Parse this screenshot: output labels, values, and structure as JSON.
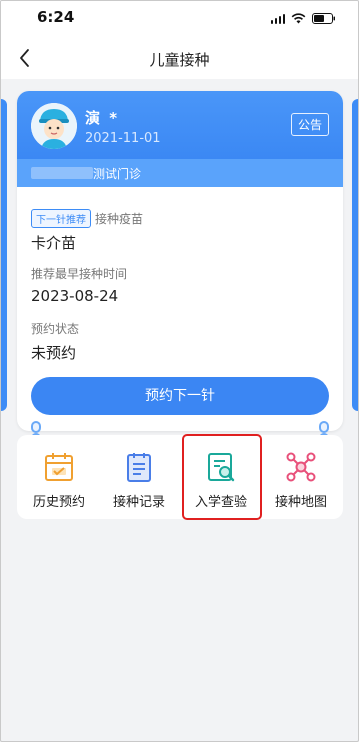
{
  "status_bar": {
    "time": "6:24"
  },
  "nav": {
    "title": "儿童接种"
  },
  "child": {
    "name": "演 *",
    "dob": "2021-11-01",
    "clinic": "测试门诊"
  },
  "notice_label": "公告",
  "next_vaccine": {
    "tag": "下一针推荐",
    "vaccine_label": "接种疫苗",
    "vaccine_name": "卡介苗",
    "time_label": "推荐最早接种时间",
    "time_value": "2023-08-24",
    "status_label": "预约状态",
    "status_value": "未预约"
  },
  "book_button": "预约下一针",
  "menu": [
    {
      "label": "历史预约",
      "icon": "calendar-icon",
      "color": "#f0a030"
    },
    {
      "label": "接种记录",
      "icon": "record-list-icon",
      "color": "#4a7ee8"
    },
    {
      "label": "入学查验",
      "icon": "document-search-icon",
      "color": "#1aa89a"
    },
    {
      "label": "接种地图",
      "icon": "map-network-icon",
      "color": "#e8507a"
    }
  ],
  "colors": {
    "primary": "#3b86f3",
    "highlight": "#e02020"
  }
}
